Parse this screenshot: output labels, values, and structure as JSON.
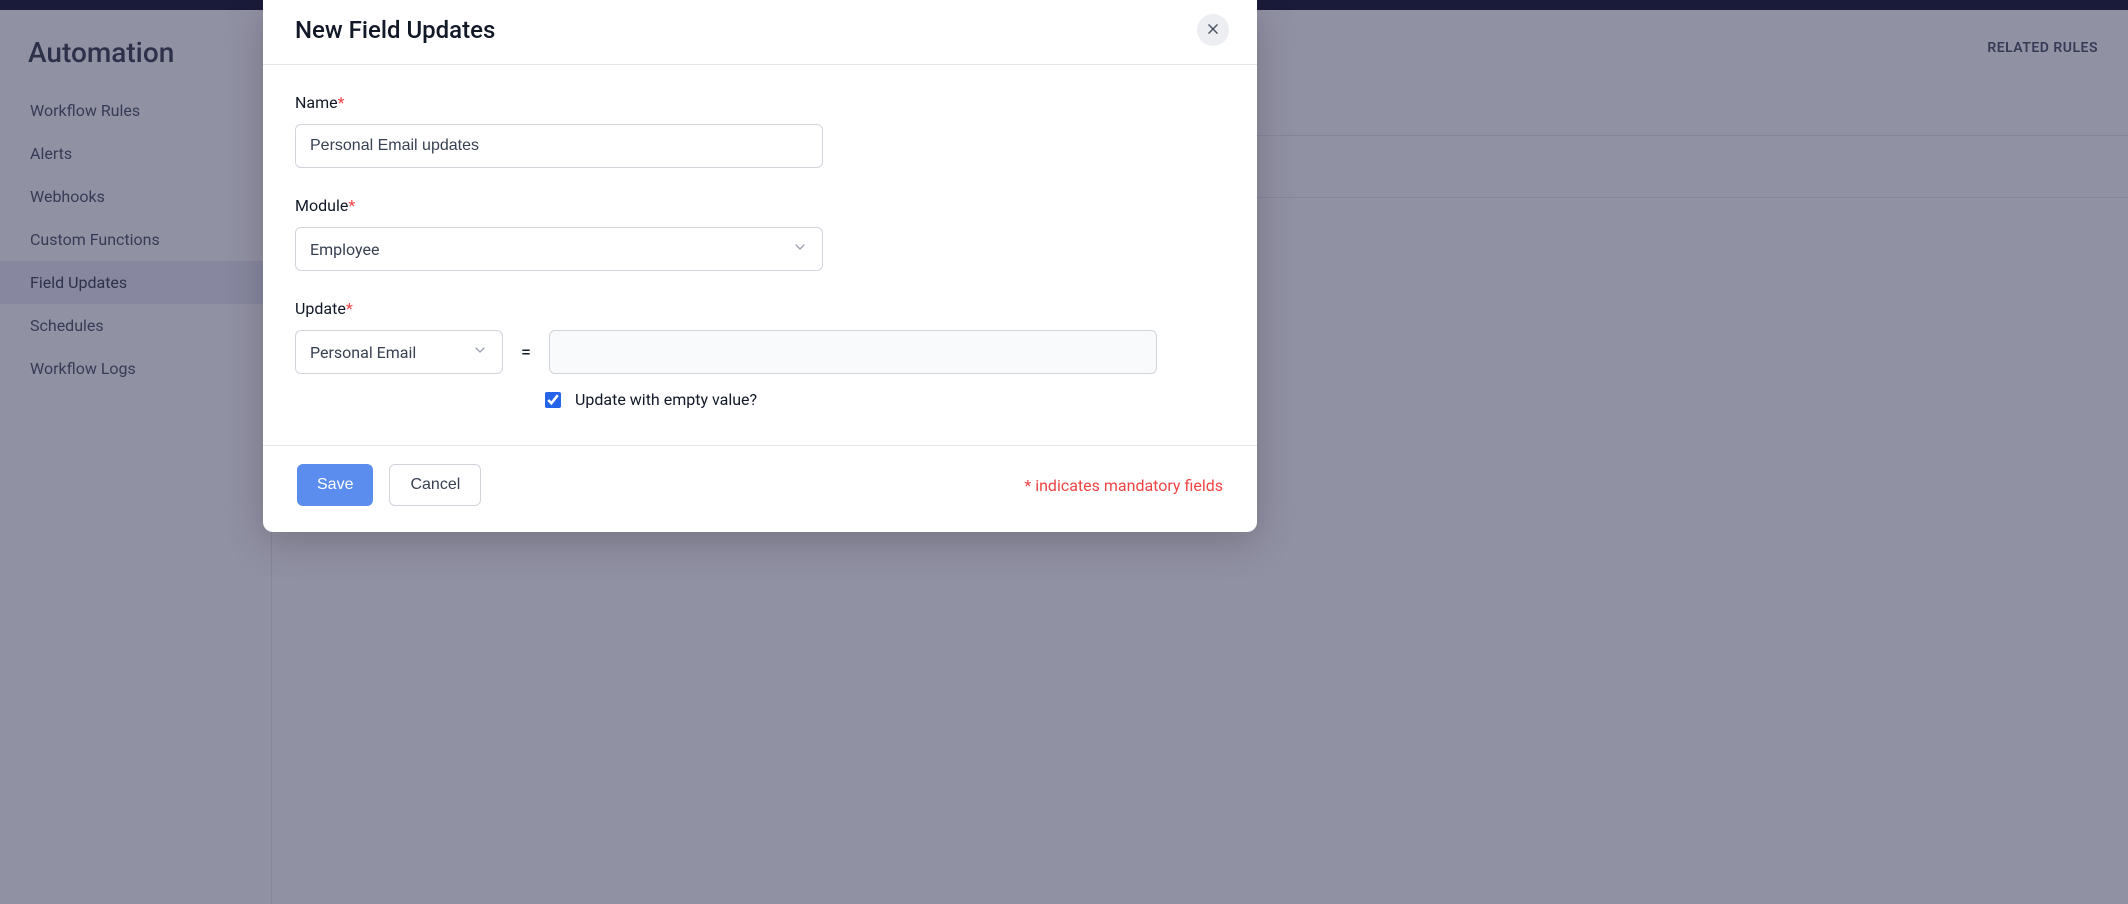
{
  "sidebar": {
    "title": "Automation",
    "items": [
      {
        "label": "Workflow Rules",
        "active": false
      },
      {
        "label": "Alerts",
        "active": false
      },
      {
        "label": "Webhooks",
        "active": false
      },
      {
        "label": "Custom Functions",
        "active": false
      },
      {
        "label": "Field Updates",
        "active": true
      },
      {
        "label": "Schedules",
        "active": false
      },
      {
        "label": "Workflow Logs",
        "active": false
      }
    ]
  },
  "main": {
    "related_rules": "RELATED RULES"
  },
  "modal": {
    "title": "New Field Updates",
    "name_label": "Name",
    "name_value": "Personal Email updates",
    "module_label": "Module",
    "module_value": "Employee",
    "update_label": "Update",
    "update_field": "Personal Email",
    "equals": "=",
    "update_value": "",
    "empty_checkbox_label": "Update with empty value?",
    "empty_checkbox_checked": true,
    "save_label": "Save",
    "cancel_label": "Cancel",
    "mandatory_note": "* indicates mandatory fields",
    "asterisk": "*"
  }
}
